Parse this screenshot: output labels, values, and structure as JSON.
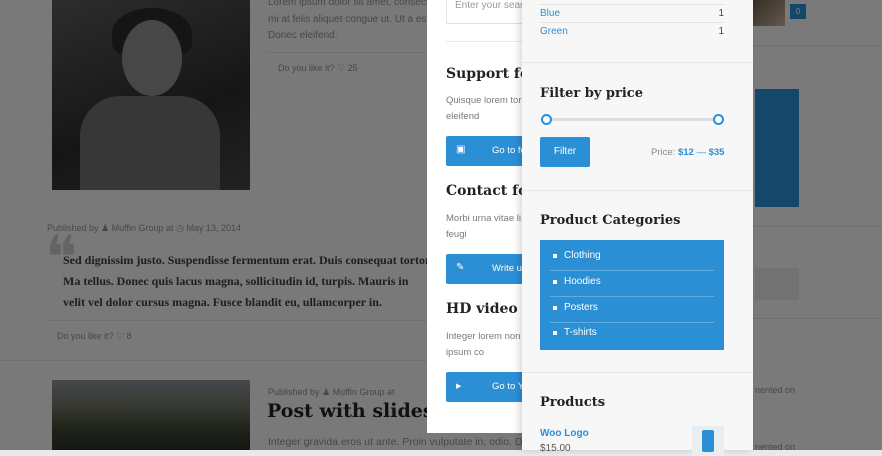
{
  "blog": {
    "post1_text_lines": [
      "Lorem ipsum dolor sit amet, consectet",
      "mi at felis aliquet congue ut. Ut a est eget",
      "Donec eleifend."
    ],
    "post1_likes": {
      "label": "Do you like it?",
      "count": "25"
    },
    "quote_meta": {
      "published_by": "Published by",
      "author": "Muffin Group",
      "at": "at",
      "date": "May 13, 2014"
    },
    "quote_text": "Sed dignissim justo. Suspendisse fermentum erat. Duis consequat tortor. Ma tellus. Donec quis lacus magna, sollicitudin id, turpis. Mauris in velit vel dolor cursus magna. Fusce blandit eu, ullamcorper in.",
    "quote_likes": {
      "label": "Do you like it?",
      "count": "8"
    },
    "post3_meta": {
      "published_by": "Published by",
      "author": "Muffin Group",
      "at": "at"
    },
    "post3_title": "Post with slideshow",
    "post3_text": "Integer gravida eros ut ante. Proin vulputate in, odio. Donec sagittis.",
    "right_badge": "0",
    "right_commented_1": "nented on",
    "right_commented_2": "nented on"
  },
  "middle_panel": {
    "search_placeholder": "Enter your search",
    "sections": [
      {
        "title": "Support forum",
        "text": "Quisque lorem tor bulum id, eleifend",
        "button": "Go to forum",
        "icon": "chat-icon"
      },
      {
        "title": "Contact form",
        "text": "Morbi urna vitae li congue non, feugi",
        "button": "Write us",
        "icon": "compose-icon"
      },
      {
        "title": "HD video tutorials",
        "text": "Integer lorem non eleifend ipsum co",
        "button": "Go to YouTube",
        "icon": "play-icon"
      }
    ]
  },
  "filter_panel": {
    "colors": [
      {
        "name": "Blue",
        "count": "1"
      },
      {
        "name": "Green",
        "count": "1"
      }
    ],
    "filter_by_price": {
      "title": "Filter by price",
      "button": "Filter",
      "price_prefix": "Price:",
      "min": "$12",
      "separator": "—",
      "max": "$35"
    },
    "categories": {
      "title": "Product Categories",
      "items": [
        "Clothing",
        "Hoodies",
        "Posters",
        "T-shirts"
      ]
    },
    "products": {
      "title": "Products",
      "items": [
        {
          "name": "Woo Logo",
          "price": "$15.00"
        }
      ]
    }
  },
  "colors": {
    "accent": "#2b8fd6",
    "overlay": "rgba(0,0,0,0.5)"
  }
}
